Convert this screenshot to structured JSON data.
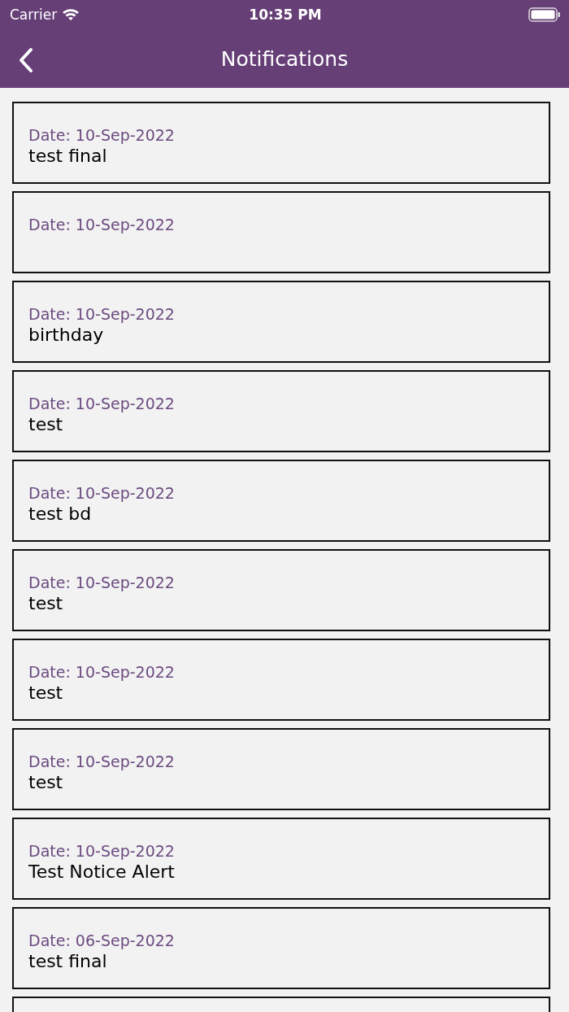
{
  "status_bar": {
    "carrier": "Carrier",
    "time": "10:35 PM"
  },
  "header": {
    "title": "Notifications"
  },
  "notifications": [
    {
      "date": "Date: 10-Sep-2022",
      "message": "test final"
    },
    {
      "date": "Date: 10-Sep-2022"
    },
    {
      "date": "Date: 10-Sep-2022",
      "message": "birthday"
    },
    {
      "date": "Date: 10-Sep-2022",
      "message": "test"
    },
    {
      "date": "Date: 10-Sep-2022",
      "message": "test bd"
    },
    {
      "date": "Date: 10-Sep-2022",
      "message": "test"
    },
    {
      "date": "Date: 10-Sep-2022",
      "message": "test"
    },
    {
      "date": "Date: 10-Sep-2022",
      "message": "test"
    },
    {
      "date": "Date: 10-Sep-2022",
      "message": "Test Notice Alert"
    },
    {
      "date": "Date: 06-Sep-2022",
      "message": "test final"
    }
  ],
  "more_below": true
}
